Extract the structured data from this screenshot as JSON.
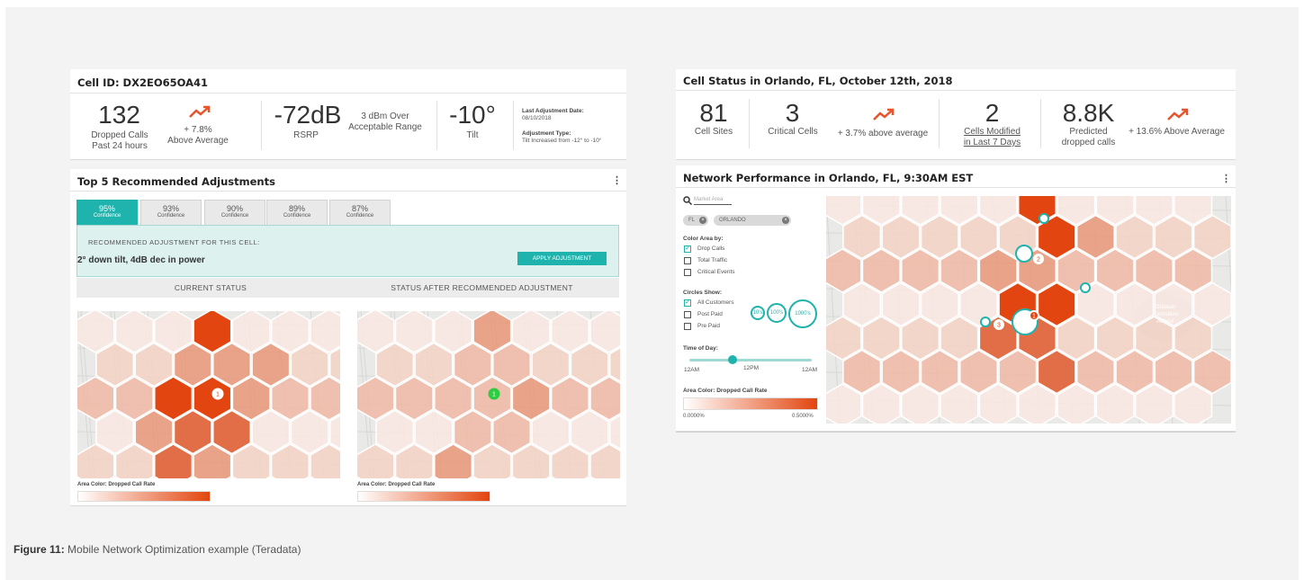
{
  "left_card": {
    "title": "Cell ID: DX2EO65OA41",
    "metrics": {
      "dropped_calls_value": "132",
      "dropped_calls_label": "Dropped Calls",
      "dropped_calls_period": "Past 24 hours",
      "trend_pct": "+ 7.8%",
      "trend_label": "Above Average",
      "rsrp_value": "-72dB",
      "rsrp_label": "RSRP",
      "rsrp_note_1": "3 dBm Over",
      "rsrp_note_2": "Acceptable Range",
      "tilt_value": "-10°",
      "tilt_label": "Tilt",
      "last_adj_title": "Last Adjustment Date:",
      "last_adj_date": "08/10/2018",
      "adj_type_title": "Adjustment Type:",
      "adj_type_value": "Tilt Increased from -12° to -10°"
    }
  },
  "recommend": {
    "title": "Top 5 Recommended Adjustments",
    "tabs": [
      {
        "pct": "95%",
        "label": "Confidence"
      },
      {
        "pct": "93%",
        "label": "Confidence"
      },
      {
        "pct": "90%",
        "label": "Confidence"
      },
      {
        "pct": "89%",
        "label": "Confidence"
      },
      {
        "pct": "87%",
        "label": "Confidence"
      }
    ],
    "box_heading": "RECOMMENDED ADJUSTMENT FOR THIS CELL:",
    "box_value": "2° down tilt,  4dB dec in power",
    "apply_label": "APPLY ADJUSTMENT",
    "current_status": "CURRENT STATUS",
    "after_status": "STATUS AFTER RECOMMENDED ADJUSTMENT",
    "marker_current": "1",
    "marker_after": "1",
    "legend_label": "Area Color: Dropped Call Rate"
  },
  "status_card": {
    "title": "Cell Status in Orlando, FL, October 12th, 2018",
    "cell_sites_value": "81",
    "cell_sites_label": "Cell Sites",
    "critical_value": "3",
    "critical_label": "Critical Cells",
    "critical_trend": "+ 3.7% above average",
    "modified_value": "2",
    "modified_label_1": "Cells Modified",
    "modified_label_2": "in Last 7 Days",
    "predicted_value": "8.8K",
    "predicted_label_1": "Predicted",
    "predicted_label_2": "dropped calls",
    "predicted_trend": "+ 13.6% Above Average"
  },
  "network": {
    "title": "Network Performance in Orlando, FL, 9:30AM EST",
    "search_placeholder": "Market Area",
    "chips": [
      "FL",
      "ORLANDO"
    ],
    "color_area_label": "Color Area by:",
    "color_options": [
      {
        "label": "Drop Calls",
        "checked": true
      },
      {
        "label": "Total Traffic",
        "checked": false
      },
      {
        "label": "Critical Events",
        "checked": false
      }
    ],
    "circles_label": "Circles Show:",
    "circle_options": [
      {
        "label": "All Customers",
        "checked": true
      },
      {
        "label": "Post Paid",
        "checked": false
      },
      {
        "label": "Pre Paid",
        "checked": false
      }
    ],
    "ring_sizes": [
      "10's",
      "100's",
      "1000's"
    ],
    "time_label": "Time of Day:",
    "time_ticks": [
      "12AM",
      "12PM",
      "12AM"
    ],
    "time_value": 0.35,
    "legend_label": "Area Color: Dropped Call Rate",
    "legend_min": "0.0000%",
    "legend_max": "0.5000%",
    "map_markers": [
      "1",
      "2",
      "3"
    ],
    "airport_label_1": "Orlando",
    "airport_label_2": "Executive",
    "airport_label_3": "Airport"
  },
  "caption": {
    "prefix": "Figure 11:",
    "text": " Mobile Network Optimization example (Teradata)"
  },
  "colors": {
    "accent": "#1fb3ad",
    "hot": "#e2450f",
    "trend": "#e8542a"
  }
}
